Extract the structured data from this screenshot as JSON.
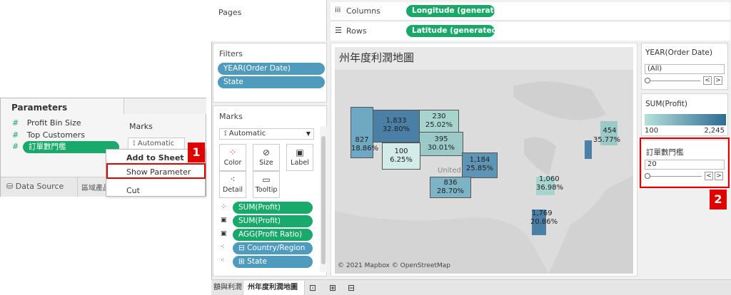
{
  "params_panel": {
    "title": "Parameters",
    "items": [
      {
        "label": "Profit Bin Size"
      },
      {
        "label": "Top Customers"
      },
      {
        "label": "訂單數門檻"
      }
    ],
    "marks_label": "Marks",
    "marks_type": "Automatic",
    "context_menu": [
      "Add to Sheet",
      "Show Parameter",
      "Cut"
    ],
    "data_source": "Data Source",
    "sheet_tab": "區域產品"
  },
  "callouts": {
    "one": "1",
    "two": "2"
  },
  "shelves": {
    "pages": "Pages",
    "columns_label": "Columns",
    "rows_label": "Rows",
    "columns_pill": "Longitude (generated)",
    "rows_pill": "Latitude (generated)"
  },
  "filters": {
    "title": "Filters",
    "items": [
      "YEAR(Order Date)",
      "State"
    ]
  },
  "marks": {
    "title": "Marks",
    "type": "Automatic",
    "buttons": [
      "Color",
      "Size",
      "Label",
      "Detail",
      "Tooltip"
    ],
    "fields": [
      {
        "icon": "color",
        "label": "SUM(Profit)"
      },
      {
        "icon": "label",
        "label": "SUM(Profit)"
      },
      {
        "icon": "label",
        "label": "AGG(Profit Ratio)"
      },
      {
        "icon": "detail",
        "label": "Country/Region"
      },
      {
        "icon": "detail",
        "label": "State"
      }
    ]
  },
  "map": {
    "title": "州年度利潤地圖",
    "attribution": "© 2021 Mapbox © OpenStreetMap",
    "country_label": "United",
    "states": [
      {
        "value": "1,833",
        "ratio": "32.80%"
      },
      {
        "value": "230",
        "ratio": "25.02%"
      },
      {
        "value": "827",
        "ratio": "18.86%"
      },
      {
        "value": "395",
        "ratio": "30.01%"
      },
      {
        "value": "100",
        "ratio": "6.25%"
      },
      {
        "value": "1,184",
        "ratio": "25.85%"
      },
      {
        "value": "836",
        "ratio": "28.70%"
      },
      {
        "value": "1,060",
        "ratio": "36.98%"
      },
      {
        "value": "1,769",
        "ratio": "20.86%"
      },
      {
        "value": "454",
        "ratio": "35.77%"
      }
    ]
  },
  "right_panel": {
    "year_title": "YEAR(Order Date)",
    "year_value": "(All)",
    "profit_title": "SUM(Profit)",
    "profit_min": "100",
    "profit_max": "2,245",
    "param_title": "訂單數門檻",
    "param_value": "20"
  },
  "tabs": [
    "額與利潤",
    "州年度利潤地圖"
  ],
  "colors": {
    "pill_green": "#18a96b",
    "pill_blue": "#4f9bbd",
    "callout_red": "#e10000"
  }
}
